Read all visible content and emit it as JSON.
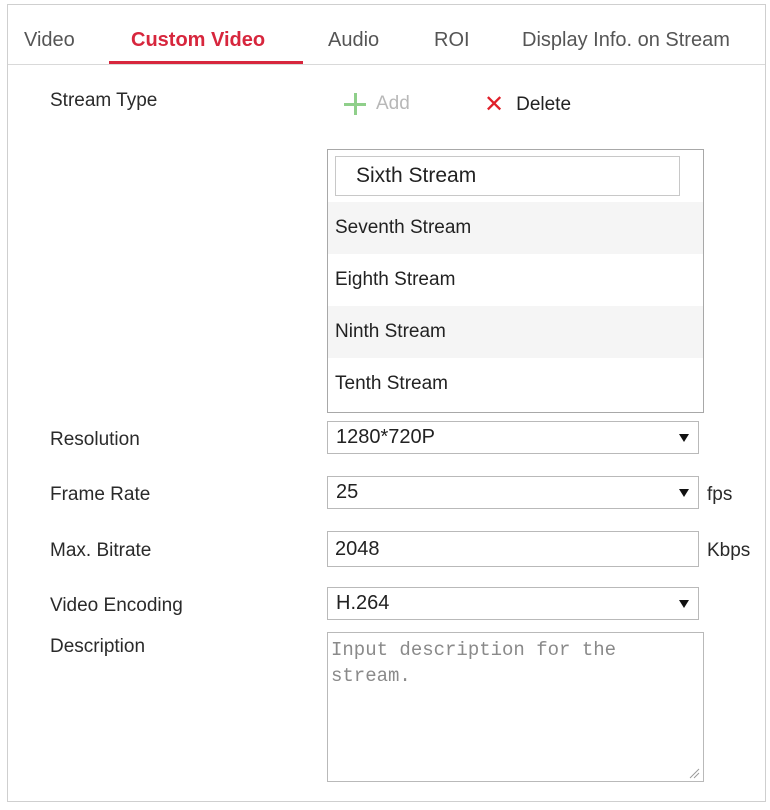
{
  "tabs": [
    {
      "label": "Video",
      "active": false
    },
    {
      "label": "Custom Video",
      "active": true
    },
    {
      "label": "Audio",
      "active": false
    },
    {
      "label": "ROI",
      "active": false
    },
    {
      "label": "Display Info. on Stream",
      "active": false
    }
  ],
  "form": {
    "stream_type_label": "Stream Type",
    "add_label": "Add",
    "delete_label": "Delete",
    "streams": [
      "Sixth Stream",
      "Seventh Stream",
      "Eighth Stream",
      "Ninth Stream",
      "Tenth Stream"
    ],
    "resolution_label": "Resolution",
    "resolution_value": "1280*720P",
    "frame_rate_label": "Frame Rate",
    "frame_rate_value": "25",
    "frame_rate_unit": "fps",
    "max_bitrate_label": "Max. Bitrate",
    "max_bitrate_value": "2048",
    "max_bitrate_unit": "Kbps",
    "video_encoding_label": "Video Encoding",
    "video_encoding_value": "H.264",
    "description_label": "Description",
    "description_placeholder": "Input description for the stream."
  },
  "icons": {
    "add": "plus-icon",
    "delete": "x-icon",
    "dropdown": "caret-down-icon"
  },
  "colors": {
    "accent": "#d7263d",
    "add_icon": "#8fcf8a",
    "delete_icon": "#e0202a"
  }
}
